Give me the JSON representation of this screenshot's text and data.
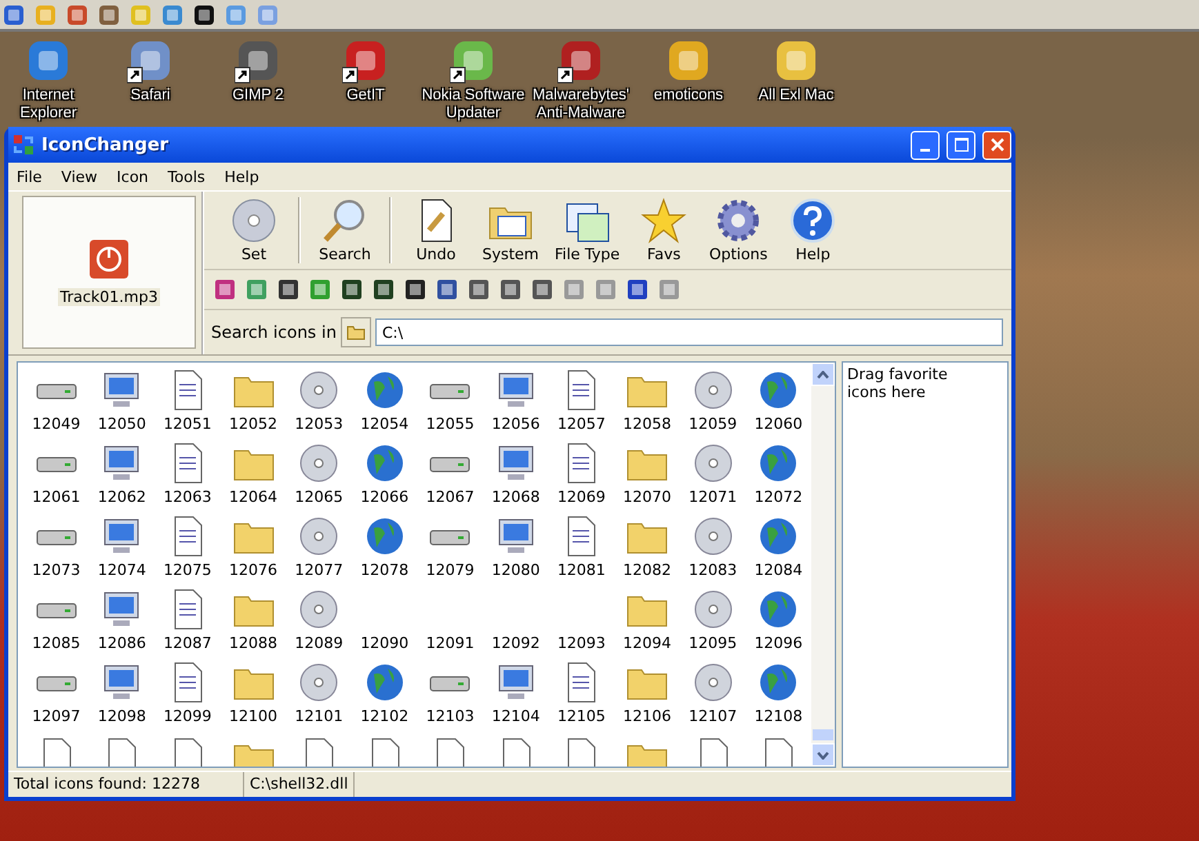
{
  "desktop_icons": [
    {
      "label": "Internet Explorer",
      "shortcut": false
    },
    {
      "label": "Safari",
      "shortcut": true
    },
    {
      "label": "GIMP 2",
      "shortcut": true
    },
    {
      "label": "GetIT",
      "shortcut": true
    },
    {
      "label": "Nokia Software Updater",
      "shortcut": true
    },
    {
      "label": "Malwarebytes' Anti-Malware",
      "shortcut": true
    },
    {
      "label": "emoticons",
      "shortcut": false
    },
    {
      "label": "All Exl Mac",
      "shortcut": false
    }
  ],
  "window": {
    "title": "IconChanger"
  },
  "menu": [
    "File",
    "View",
    "Icon",
    "Tools",
    "Help"
  ],
  "preview": {
    "label": "Track01.mp3"
  },
  "big_buttons": [
    "Set",
    "Search",
    "Undo",
    "System",
    "File Type",
    "Favs",
    "Options",
    "Help"
  ],
  "search": {
    "label": "Search icons in",
    "value": "C:\\"
  },
  "icons": [
    {
      "label": "12049",
      "empty": false
    },
    {
      "label": "12050",
      "empty": false
    },
    {
      "label": "12051",
      "empty": false
    },
    {
      "label": "12052",
      "empty": false
    },
    {
      "label": "12053",
      "empty": false
    },
    {
      "label": "12054",
      "empty": false
    },
    {
      "label": "12055",
      "empty": false
    },
    {
      "label": "12056",
      "empty": false
    },
    {
      "label": "12057",
      "empty": false
    },
    {
      "label": "12058",
      "empty": false
    },
    {
      "label": "12059",
      "empty": false
    },
    {
      "label": "12060",
      "empty": false
    },
    {
      "label": "12061",
      "empty": false
    },
    {
      "label": "12062",
      "empty": false
    },
    {
      "label": "12063",
      "empty": false
    },
    {
      "label": "12064",
      "empty": false
    },
    {
      "label": "12065",
      "empty": false
    },
    {
      "label": "12066",
      "empty": false
    },
    {
      "label": "12067",
      "empty": false
    },
    {
      "label": "12068",
      "empty": false
    },
    {
      "label": "12069",
      "empty": false
    },
    {
      "label": "12070",
      "empty": false
    },
    {
      "label": "12071",
      "empty": false
    },
    {
      "label": "12072",
      "empty": false
    },
    {
      "label": "12073",
      "empty": false
    },
    {
      "label": "12074",
      "empty": false
    },
    {
      "label": "12075",
      "empty": false
    },
    {
      "label": "12076",
      "empty": false
    },
    {
      "label": "12077",
      "empty": false
    },
    {
      "label": "12078",
      "empty": false
    },
    {
      "label": "12079",
      "empty": false
    },
    {
      "label": "12080",
      "empty": false
    },
    {
      "label": "12081",
      "empty": false
    },
    {
      "label": "12082",
      "empty": false
    },
    {
      "label": "12083",
      "empty": false
    },
    {
      "label": "12084",
      "empty": false
    },
    {
      "label": "12085",
      "empty": false
    },
    {
      "label": "12086",
      "empty": false
    },
    {
      "label": "12087",
      "empty": false
    },
    {
      "label": "12088",
      "empty": false
    },
    {
      "label": "12089",
      "empty": false
    },
    {
      "label": "12090",
      "empty": true
    },
    {
      "label": "12091",
      "empty": true
    },
    {
      "label": "12092",
      "empty": true
    },
    {
      "label": "12093",
      "empty": true
    },
    {
      "label": "12094",
      "empty": false
    },
    {
      "label": "12095",
      "empty": false
    },
    {
      "label": "12096",
      "empty": false
    },
    {
      "label": "12097",
      "empty": false
    },
    {
      "label": "12098",
      "empty": false
    },
    {
      "label": "12099",
      "empty": false
    },
    {
      "label": "12100",
      "empty": false
    },
    {
      "label": "12101",
      "empty": false
    },
    {
      "label": "12102",
      "empty": false
    },
    {
      "label": "12103",
      "empty": false
    },
    {
      "label": "12104",
      "empty": false
    },
    {
      "label": "12105",
      "empty": false
    },
    {
      "label": "12106",
      "empty": false
    },
    {
      "label": "12107",
      "empty": false
    },
    {
      "label": "12108",
      "empty": false
    }
  ],
  "favorites_hint": "Drag favorite icons here",
  "status_bar": [
    "Total icons found: 12278",
    "C:\\shell32.dll"
  ]
}
